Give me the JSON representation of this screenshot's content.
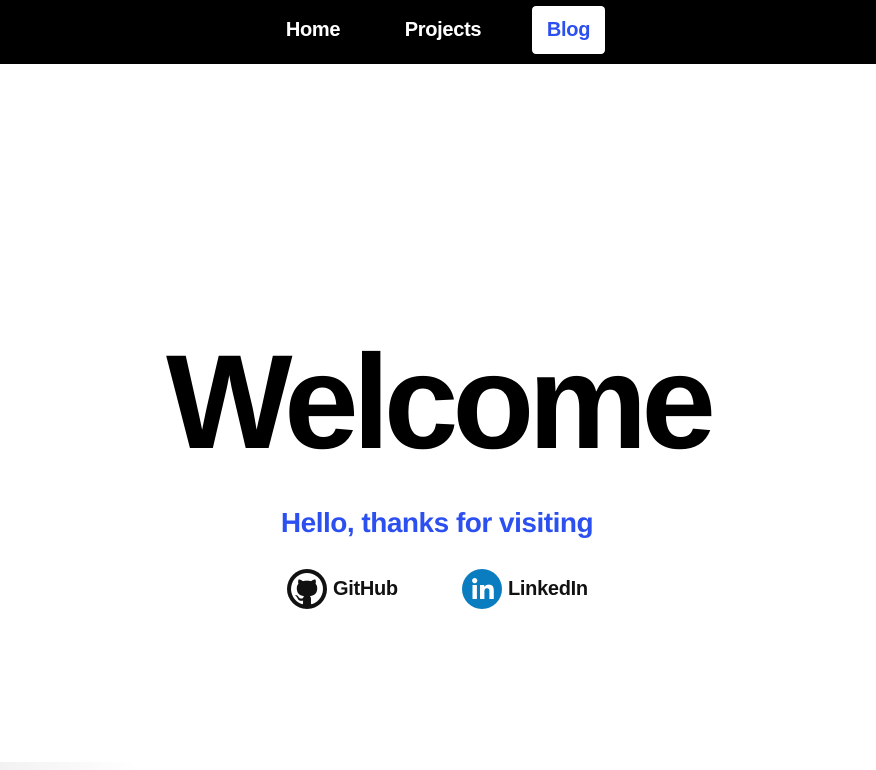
{
  "nav": {
    "items": [
      {
        "label": "Home",
        "active": false
      },
      {
        "label": "Projects",
        "active": false
      },
      {
        "label": "Blog",
        "active": true
      }
    ]
  },
  "hero": {
    "title": "Welcome",
    "subtitle": "Hello, thanks for visiting"
  },
  "social": {
    "links": [
      {
        "label": "GitHub",
        "icon": "github-icon"
      },
      {
        "label": "LinkedIn",
        "icon": "linkedin-icon"
      }
    ]
  },
  "colors": {
    "nav_background": "#000000",
    "accent": "#2c4ff0",
    "linkedin_brand": "#0a7cc0",
    "text": "#000000",
    "background": "#ffffff"
  }
}
